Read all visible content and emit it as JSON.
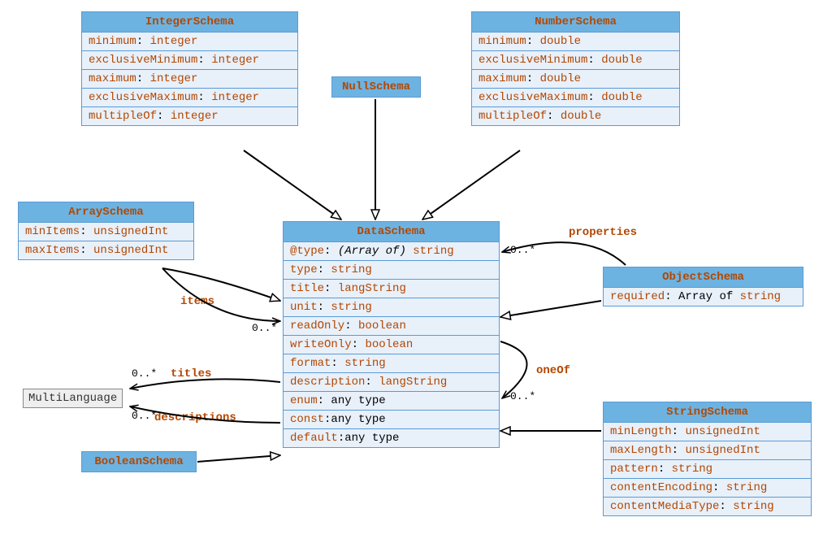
{
  "classes": {
    "IntegerSchema": {
      "title": "IntegerSchema",
      "attrs": [
        {
          "name": "minimum",
          "type": "integer"
        },
        {
          "name": "exclusiveMinimum",
          "type": "integer"
        },
        {
          "name": "maximum",
          "type": "integer"
        },
        {
          "name": "exclusiveMaximum",
          "type": "integer"
        },
        {
          "name": "multipleOf",
          "type": "integer"
        }
      ]
    },
    "NumberSchema": {
      "title": "NumberSchema",
      "attrs": [
        {
          "name": "minimum",
          "type": "double"
        },
        {
          "name": "exclusiveMinimum",
          "type": "double"
        },
        {
          "name": "maximum",
          "type": "double"
        },
        {
          "name": "exclusiveMaximum",
          "type": "double"
        },
        {
          "name": "multipleOf",
          "type": "double"
        }
      ]
    },
    "NullSchema": {
      "title": "NullSchema"
    },
    "ArraySchema": {
      "title": "ArraySchema",
      "attrs": [
        {
          "name": "minItems",
          "type": "unsignedInt"
        },
        {
          "name": "maxItems",
          "type": "unsignedInt"
        }
      ]
    },
    "DataSchema": {
      "title": "DataSchema",
      "attrs": [
        {
          "name": "@type",
          "modifier": "(Array of)",
          "type": "string"
        },
        {
          "name": "type",
          "type": "string"
        },
        {
          "name": "title",
          "type": "langString"
        },
        {
          "name": "unit",
          "type": "string"
        },
        {
          "name": "readOnly",
          "type": "boolean"
        },
        {
          "name": "writeOnly",
          "type": "boolean"
        },
        {
          "name": "format",
          "type": "string"
        },
        {
          "name": "description",
          "type": "langString"
        },
        {
          "name": "enum",
          "typeBlack": "any type"
        },
        {
          "name": "const",
          "typeBlack": "any type"
        },
        {
          "name": "default",
          "typeBlack": "any type"
        }
      ]
    },
    "ObjectSchema": {
      "title": "ObjectSchema",
      "attrs": [
        {
          "name": "required",
          "typeMixed": {
            "pre": "Array of ",
            "link": "string"
          }
        }
      ]
    },
    "StringSchema": {
      "title": "StringSchema",
      "attrs": [
        {
          "name": "minLength",
          "type": "unsignedInt"
        },
        {
          "name": "maxLength",
          "type": "unsignedInt"
        },
        {
          "name": "pattern",
          "type": "string"
        },
        {
          "name": "contentEncoding",
          "type": "string"
        },
        {
          "name": "contentMediaType",
          "type": "string"
        }
      ]
    },
    "BooleanSchema": {
      "title": "BooleanSchema"
    }
  },
  "multiLanguage": "MultiLanguage",
  "assoc": {
    "items": "items",
    "titles": "titles",
    "descriptions": "descriptions",
    "properties": "properties",
    "oneOf": "oneOf"
  },
  "mult": {
    "items": "0..*",
    "titles": "0..*",
    "descriptions": "0..*",
    "properties": "0..*",
    "oneOf": "0..*"
  }
}
